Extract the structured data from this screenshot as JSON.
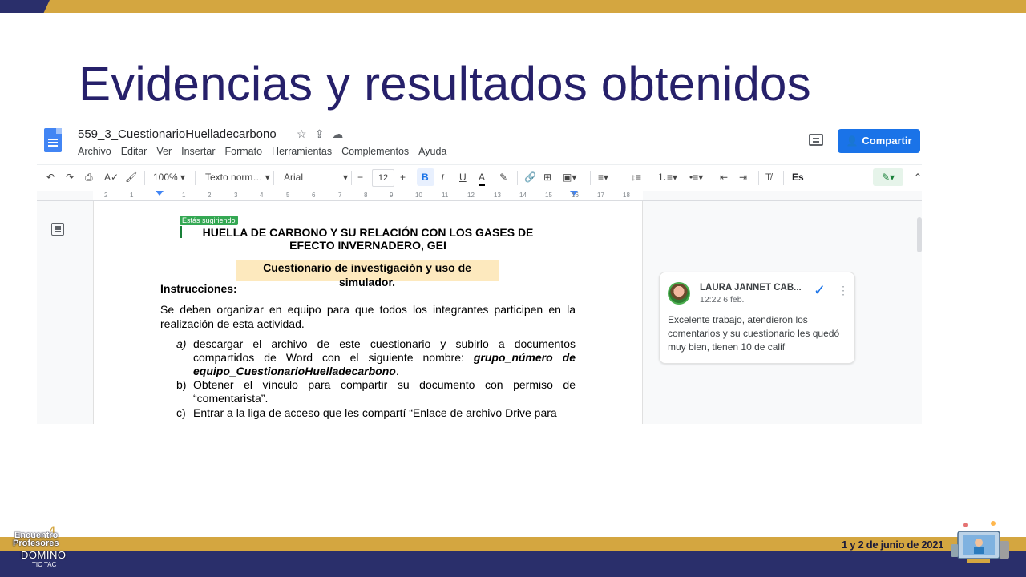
{
  "slide": {
    "title": "Evidencias y resultados obtenidos",
    "date": "1 y 2 de junio de 2021",
    "logo": {
      "line1": "Encuentro",
      "line2": "Profesores",
      "line3": "DOMINO",
      "line4": "TIC TAC",
      "number": "4"
    }
  },
  "docs": {
    "doc_title": "559_3_CuestionarioHuelladecarbono",
    "menu": [
      "Archivo",
      "Editar",
      "Ver",
      "Insertar",
      "Formato",
      "Herramientas",
      "Complementos",
      "Ayuda"
    ],
    "share_label": "Compartir",
    "toolbar": {
      "zoom": "100%",
      "style": "Texto norm…",
      "font": "Arial",
      "font_size": "12",
      "language": "Es"
    },
    "ruler_marks": [
      "2",
      "1",
      "1",
      "2",
      "3",
      "4",
      "5",
      "6",
      "7",
      "8",
      "9",
      "10",
      "11",
      "12",
      "13",
      "14",
      "15",
      "16",
      "17",
      "18"
    ],
    "suggest_tag": "Estás sugiriendo",
    "heading": "HUELLA DE CARBONO Y SU RELACIÓN CON LOS GASES DE EFECTO INVERNADERO, GEI",
    "subheading": "Cuestionario de investigación y uso de simulador.",
    "instructions_label": "Instrucciones:",
    "intro": "Se deben organizar en equipo para que todos los integrantes participen en la realización de esta actividad.",
    "items": [
      {
        "label": "a)",
        "text": "descargar el archivo de este cuestionario y subirlo a documentos compartidos de Word con el siguiente nombre: ",
        "emph": "grupo_número de equipo_CuestionarioHuelladecarbono",
        "tail": "."
      },
      {
        "label": "b)",
        "text": "Obtener el vínculo para compartir su documento con permiso de “comentarista”."
      },
      {
        "label": "c)",
        "text": "Entrar a la liga de acceso que les compartí “Enlace de archivo Drive para"
      }
    ],
    "comment": {
      "author": "LAURA JANNET CAB...",
      "time": "12:22 6 feb.",
      "text": "Excelente trabajo, atendieron los comentarios y su cuestionario les quedó muy bien, tienen 10 de calif"
    },
    "colors": {
      "accent": "#1a73e8",
      "suggest": "#34a853",
      "highlight": "#fde9be",
      "slide_title": "#26206a",
      "gold": "#d4a640",
      "navy": "#2a2f6b"
    }
  }
}
